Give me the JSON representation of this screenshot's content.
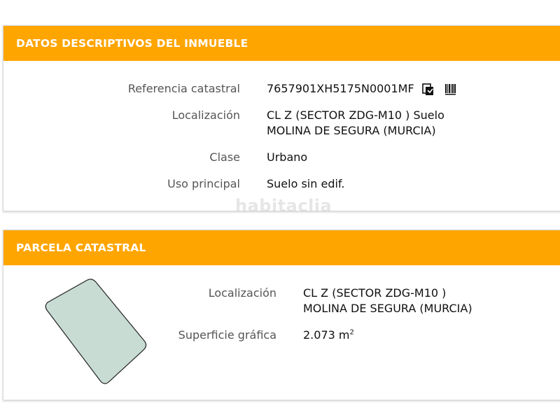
{
  "datos": {
    "title": "DATOS DESCRIPTIVOS DEL INMUEBLE",
    "rows": [
      {
        "label": "Referencia catastral",
        "value": "7657901XH5175N0001MF"
      },
      {
        "label": "Localización",
        "line1": "CL Z (SECTOR ZDG-M10 ) Suelo",
        "line2": "MOLINA DE SEGURA (MURCIA)"
      },
      {
        "label": "Clase",
        "value": "Urbano"
      },
      {
        "label": "Uso principal",
        "value": "Suelo sin edif."
      }
    ]
  },
  "watermark": "habitaclia",
  "parcela": {
    "title": "PARCELA CATASTRAL",
    "localizacion_label": "Localización",
    "localizacion_line1": "CL Z (SECTOR ZDG-M10 )",
    "localizacion_line2": "MOLINA DE SEGURA (MURCIA)",
    "superficie_label": "Superficie gráfica",
    "superficie_value": "2.073 m",
    "superficie_unit_sup": "2"
  },
  "colors": {
    "header": "#ffa500",
    "parcel_fill": "#c8dcd4",
    "parcel_stroke": "#222222"
  },
  "icons": [
    "copy-icon",
    "barcode-icon",
    "parcel-shape-icon"
  ]
}
